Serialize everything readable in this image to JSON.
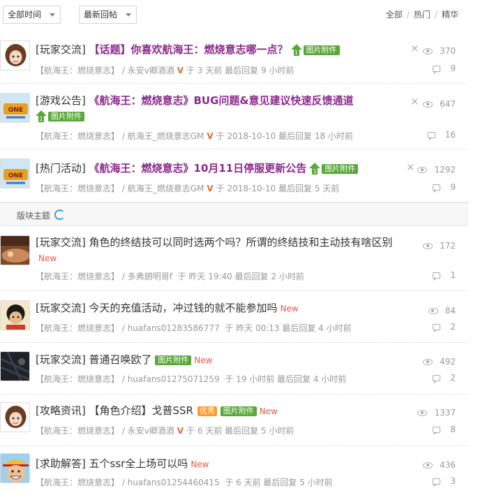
{
  "toolbar": {
    "time_select": "全部时间",
    "sort_select": "最新回帖",
    "filters": [
      "全部",
      "热门",
      "精华"
    ]
  },
  "section_label": "版块主题",
  "icons": {
    "views": "eye-icon",
    "replies": "comment-icon",
    "close": "close-icon",
    "refresh": "refresh-icon"
  },
  "colors": {
    "hot_topic": "#8c2a8c",
    "badge_green": "#5aa83a",
    "new_red": "#e65a4b",
    "good_orange": "#ff9a2e",
    "v_orange": "#e46a2c"
  },
  "posts": [
    {
      "category": "[玩家交流]",
      "title": "【话题】你喜欢航海王：燃烧意志哪一点？",
      "up_badge": "1",
      "img_badge": "图片附件",
      "forum": "【航海王：燃烧意志】",
      "author": "永安v卿酒酒",
      "v_mark": "V",
      "time": "于 3 天前 最后回复 9 小时前",
      "views": "370",
      "replies": "9",
      "close": "×"
    },
    {
      "category": "[游戏公告]",
      "title": "《航海王：燃烧意志》BUG问题&意见建议快速反馈通道",
      "up_badge": "1",
      "img_badge": "图片附件",
      "forum": "【航海王：燃烧意志】",
      "author": "航海王_燃烧意志GM",
      "v_mark": "V",
      "time": "于 2018-10-10 最后回复 18 小时前",
      "views": "647",
      "replies": "16",
      "close": "×"
    },
    {
      "category": "[热门活动]",
      "title": "《航海王：燃烧意志》10月11日停服更新公告",
      "up_badge": "1",
      "img_badge": "图片附件",
      "forum": "【航海王：燃烧意志】",
      "author": "航海王_燃烧意志GM",
      "v_mark": "V",
      "time": "于 2018-10-10 最后回复 5 天前",
      "views": "1292",
      "replies": "9",
      "close": "×"
    },
    {
      "category": "[玩家交流]",
      "title": "角色的终结技可以同时选两个吗？所谓的终结技和主动技有啥区别",
      "new": "New",
      "forum": "【航海王：燃烧意志】",
      "author": "多弗朗明哥f",
      "time": "于 昨天 19:40 最后回复 2 小时前",
      "views": "172",
      "replies": "1"
    },
    {
      "category": "[玩家交流]",
      "title": "今天的充值活动，冲过钱的就不能参加吗",
      "new": "New",
      "forum": "【航海王：燃烧意志】",
      "author": "huafans01283586777",
      "time": "于 昨天 00:13 最后回复 4 小时前",
      "views": "84",
      "replies": "2"
    },
    {
      "category": "[玩家交流]",
      "title": "普通召唤欧了",
      "img_badge": "图片附件",
      "new": "New",
      "forum": "【航海王：燃烧意志】",
      "author": "huafans01275071259",
      "time": "于 19 小时前 最后回复 4 小时前",
      "views": "492",
      "replies": "2"
    },
    {
      "category": "[攻略资讯]",
      "title": "【角色介绍】戈普SSR",
      "good": "优秀",
      "img_badge": "图片附件",
      "new": "New",
      "forum": "【航海王：燃烧意志】",
      "author": "永安v卿酒酒",
      "v_mark": "V",
      "time": "于 6 天前 最后回复 5 小时前",
      "views": "1337",
      "replies": "8"
    },
    {
      "category": "[求助解答]",
      "title": "五个ssr全上场可以吗",
      "new": "New",
      "forum": "【航海王：燃烧意志】",
      "author": "huafans01254460415",
      "time": "于 6 天前 最后回复 5 小时前",
      "views": "436",
      "replies": "3"
    }
  ]
}
